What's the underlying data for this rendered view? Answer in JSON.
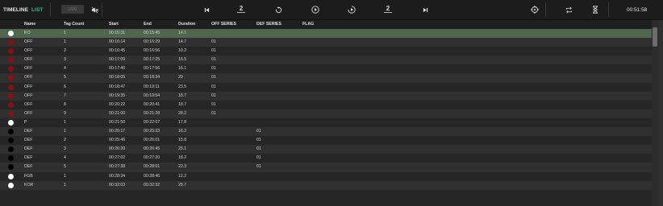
{
  "toolbar": {
    "tabs": [
      {
        "label": "TIMELINE",
        "active": false
      },
      {
        "label": "LIST",
        "active": true
      }
    ],
    "live_label": "LIVE",
    "mute_icon": "mute-speaker-icon",
    "controls": [
      {
        "name": "skip-to-start-button",
        "icon": "skip-start-icon",
        "label": ""
      },
      {
        "name": "rewind-2s-button",
        "icon": "rewind-2-icon",
        "label": "2"
      },
      {
        "name": "replay-button",
        "icon": "replay-icon",
        "label": ""
      },
      {
        "name": "play-button",
        "icon": "play-circle-icon",
        "label": ""
      },
      {
        "name": "loop-play-button",
        "icon": "loop-play-icon",
        "label": ""
      },
      {
        "name": "forward-2s-button",
        "icon": "forward-2-icon",
        "label": "2"
      },
      {
        "name": "skip-to-end-button",
        "icon": "skip-end-icon",
        "label": ""
      }
    ],
    "right_icons": [
      "target-icon",
      "repeat-icon",
      "hourglass-icon"
    ],
    "clock": "00:51:58"
  },
  "colors": {
    "active_tab": "#2fbf8a",
    "selected_row": "#50664f",
    "dot_red": "#8a0f0f",
    "dot_white": "#ffffff",
    "dot_black": "#000000"
  },
  "table": {
    "columns": [
      "Name",
      "Tag Count",
      "Start",
      "End",
      "Duration",
      "OFF SERIES",
      "DEF SERIES",
      "FLAG"
    ],
    "rows": [
      {
        "dot": "white",
        "name": "KO",
        "tag": "1",
        "start": "00:15:31",
        "end": "00:15:45",
        "dur": "14.1",
        "off": "",
        "def": "",
        "flag": "",
        "selected": true
      },
      {
        "dot": "red",
        "name": "OFF",
        "tag": "1",
        "start": "00:16:14",
        "end": "00:16:29",
        "dur": "14.7",
        "off": "01",
        "def": "",
        "flag": ""
      },
      {
        "dot": "red",
        "name": "OFF",
        "tag": "2",
        "start": "00:16:45",
        "end": "00:16:56",
        "dur": "10.2",
        "off": "01",
        "def": "",
        "flag": ""
      },
      {
        "dot": "red",
        "name": "OFF",
        "tag": "3",
        "start": "00:17:09",
        "end": "00:17:25",
        "dur": "16.5",
        "off": "01",
        "def": "",
        "flag": ""
      },
      {
        "dot": "red",
        "name": "OFF",
        "tag": "4",
        "start": "00:17:40",
        "end": "00:17:56",
        "dur": "16.1",
        "off": "01",
        "def": "",
        "flag": ""
      },
      {
        "dot": "red",
        "name": "OFF",
        "tag": "5",
        "start": "00:18:05",
        "end": "00:18:34",
        "dur": "29",
        "off": "01",
        "def": "",
        "flag": ""
      },
      {
        "dot": "red",
        "name": "OFF",
        "tag": "6",
        "start": "00:18:47",
        "end": "00:19:11",
        "dur": "23.5",
        "off": "01",
        "def": "",
        "flag": ""
      },
      {
        "dot": "red",
        "name": "OFF",
        "tag": "7",
        "start": "00:19:35",
        "end": "00:19:54",
        "dur": "18.7",
        "off": "01",
        "def": "",
        "flag": ""
      },
      {
        "dot": "red",
        "name": "OFF",
        "tag": "8",
        "start": "00:20:22",
        "end": "00:20:41",
        "dur": "18.7",
        "off": "01",
        "def": "",
        "flag": ""
      },
      {
        "dot": "red",
        "name": "OFF",
        "tag": "9",
        "start": "00:21:00",
        "end": "00:21:28",
        "dur": "28.2",
        "off": "01",
        "def": "",
        "flag": ""
      },
      {
        "dot": "white",
        "name": "P",
        "tag": "1",
        "start": "00:21:50",
        "end": "00:22:07",
        "dur": "17.8",
        "off": "",
        "def": "",
        "flag": ""
      },
      {
        "dot": "black",
        "name": "DEF",
        "tag": "1",
        "start": "00:25:17",
        "end": "00:25:33",
        "dur": "16.2",
        "off": "",
        "def": "01",
        "flag": ""
      },
      {
        "dot": "black",
        "name": "DEF",
        "tag": "2",
        "start": "00:25:46",
        "end": "00:26:01",
        "dur": "15.8",
        "off": "",
        "def": "01",
        "flag": ""
      },
      {
        "dot": "black",
        "name": "DEF",
        "tag": "3",
        "start": "00:26:20",
        "end": "00:26:45",
        "dur": "25.1",
        "off": "",
        "def": "01",
        "flag": ""
      },
      {
        "dot": "black",
        "name": "DEF",
        "tag": "4",
        "start": "00:27:02",
        "end": "00:27:20",
        "dur": "18.2",
        "off": "",
        "def": "01",
        "flag": ""
      },
      {
        "dot": "black",
        "name": "DEF",
        "tag": "5",
        "start": "00:27:38",
        "end": "00:28:01",
        "dur": "22.3",
        "off": "",
        "def": "01",
        "flag": ""
      },
      {
        "dot": "white",
        "name": "FGB",
        "tag": "1",
        "start": "00:28:34",
        "end": "00:28:46",
        "dur": "12.2",
        "off": "",
        "def": "",
        "flag": ""
      },
      {
        "dot": "white",
        "name": "KOR",
        "tag": "1",
        "start": "00:32:03",
        "end": "00:32:32",
        "dur": "28.7",
        "off": "",
        "def": "",
        "flag": ""
      }
    ]
  }
}
